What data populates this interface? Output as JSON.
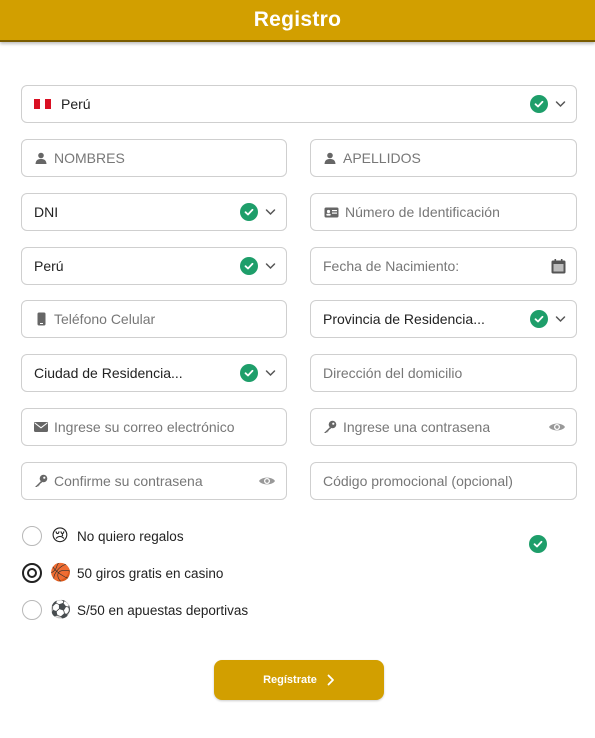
{
  "header": {
    "title": "Registro"
  },
  "country_select": {
    "value": "Perú"
  },
  "fields": {
    "nombres": {
      "placeholder": "NOMBRES"
    },
    "apellidos": {
      "placeholder": "APELLIDOS"
    },
    "doc_type": {
      "value": "DNI"
    },
    "doc_number": {
      "placeholder": "Número de Identificación"
    },
    "nationality": {
      "value": "Perú"
    },
    "birth_date": {
      "placeholder": "Fecha de Nacimiento:"
    },
    "phone": {
      "placeholder": "Teléfono Celular"
    },
    "province": {
      "value": "Provincia de Residencia..."
    },
    "city": {
      "value": "Ciudad de Residencia..."
    },
    "address": {
      "placeholder": "Dirección del domicilio"
    },
    "email": {
      "placeholder": "Ingrese su correo electrónico"
    },
    "password": {
      "placeholder": "Ingrese una contrasena"
    },
    "confirm_password": {
      "placeholder": "Confirme su contrasena"
    },
    "promo_code": {
      "placeholder": "Código promocional (opcional)"
    }
  },
  "bonus_options": [
    {
      "label": "No quiero regalos",
      "emoji": "😢",
      "selected": false
    },
    {
      "label": "50 giros gratis en casino",
      "emoji": "🏀",
      "selected": true
    },
    {
      "label": "S/50 en apuestas deportivas",
      "emoji": "⚽",
      "selected": false
    }
  ],
  "submit": {
    "label": "Regístrate"
  },
  "colors": {
    "brand": "#d29f00",
    "check": "#1e9e6a",
    "flag_red": "#d91023"
  },
  "icons": {
    "valid": "check-circle-icon",
    "dropdown": "chevron-down-icon",
    "user": "user-icon",
    "id_card": "id-card-icon",
    "calendar": "calendar-icon",
    "phone": "phone-icon",
    "email": "envelope-icon",
    "key": "key-icon",
    "eye": "eye-icon",
    "next": "chevron-right-icon"
  }
}
